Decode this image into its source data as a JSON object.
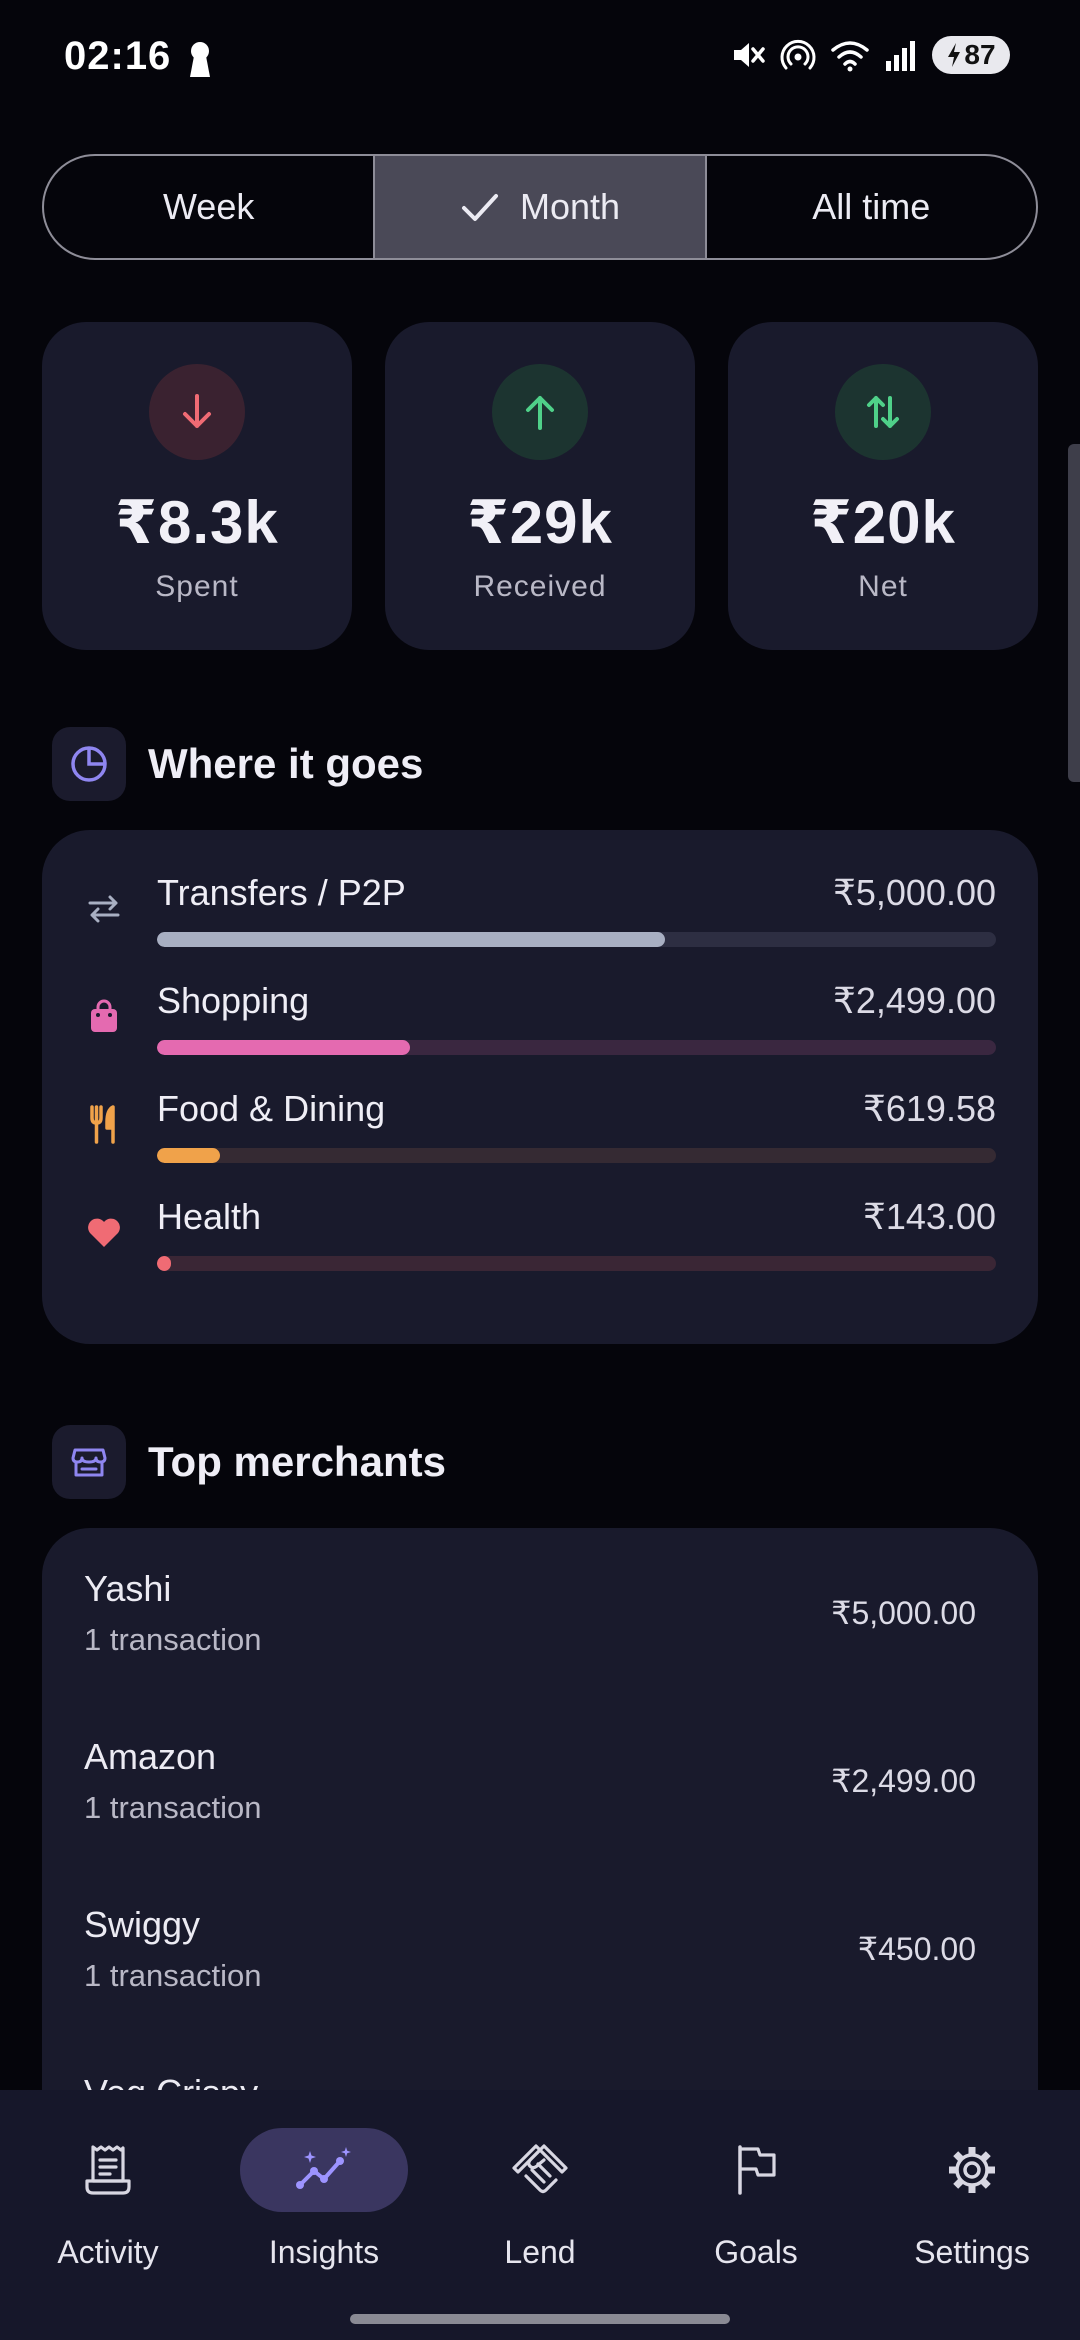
{
  "status_bar": {
    "time": "02:16",
    "battery": "87"
  },
  "period_tabs": [
    {
      "label": "Week",
      "active": false
    },
    {
      "label": "Month",
      "active": true
    },
    {
      "label": "All time",
      "active": false
    }
  ],
  "summary": [
    {
      "value": "₹8.3k",
      "label": "Spent",
      "icon": "arrow-down-icon",
      "icon_color": "#f06b74",
      "icon_bg": "#3a2230"
    },
    {
      "value": "₹29k",
      "label": "Received",
      "icon": "arrow-up-icon",
      "icon_color": "#4fd189",
      "icon_bg": "#1c3430"
    },
    {
      "value": "₹20k",
      "label": "Net",
      "icon": "arrows-up-down-icon",
      "icon_color": "#4fd189",
      "icon_bg": "#1c3430"
    }
  ],
  "where_it_goes": {
    "title": "Where it goes",
    "categories": [
      {
        "name": "Transfers / P2P",
        "amount": "₹5,000.00",
        "share": 0.605,
        "color": "#a8afc2",
        "track": "#2d2e42",
        "icon": "transfer-icon"
      },
      {
        "name": "Shopping",
        "amount": "₹2,499.00",
        "share": 0.302,
        "color": "#e46ab0",
        "track": "#3a2740",
        "icon": "shopping-bag-icon"
      },
      {
        "name": "Food & Dining",
        "amount": "₹619.58",
        "share": 0.075,
        "color": "#f0a24a",
        "track": "#352a33",
        "icon": "restaurant-icon"
      },
      {
        "name": "Health",
        "amount": "₹143.00",
        "share": 0.017,
        "color": "#f06b74",
        "track": "#3a2635",
        "icon": "heart-icon"
      }
    ]
  },
  "top_merchants": {
    "title": "Top merchants",
    "items": [
      {
        "name": "Yashi",
        "count": "1 transaction",
        "amount": "₹5,000.00"
      },
      {
        "name": "Amazon",
        "count": "1 transaction",
        "amount": "₹2,499.00"
      },
      {
        "name": "Swiggy",
        "count": "1 transaction",
        "amount": "₹450.00"
      },
      {
        "name": "Veg Crispy",
        "count": "",
        "amount": ""
      }
    ]
  },
  "nav": [
    {
      "label": "Activity",
      "icon": "receipt-icon",
      "active": false
    },
    {
      "label": "Insights",
      "icon": "insights-icon",
      "active": true
    },
    {
      "label": "Lend",
      "icon": "handshake-icon",
      "active": false
    },
    {
      "label": "Goals",
      "icon": "flag-icon",
      "active": false
    },
    {
      "label": "Settings",
      "icon": "gear-icon",
      "active": false
    }
  ],
  "colors": {
    "background": "#05050b",
    "card": "#191a2c",
    "accent": "#8f86f0",
    "nav_active_pill": "#3a3660"
  }
}
